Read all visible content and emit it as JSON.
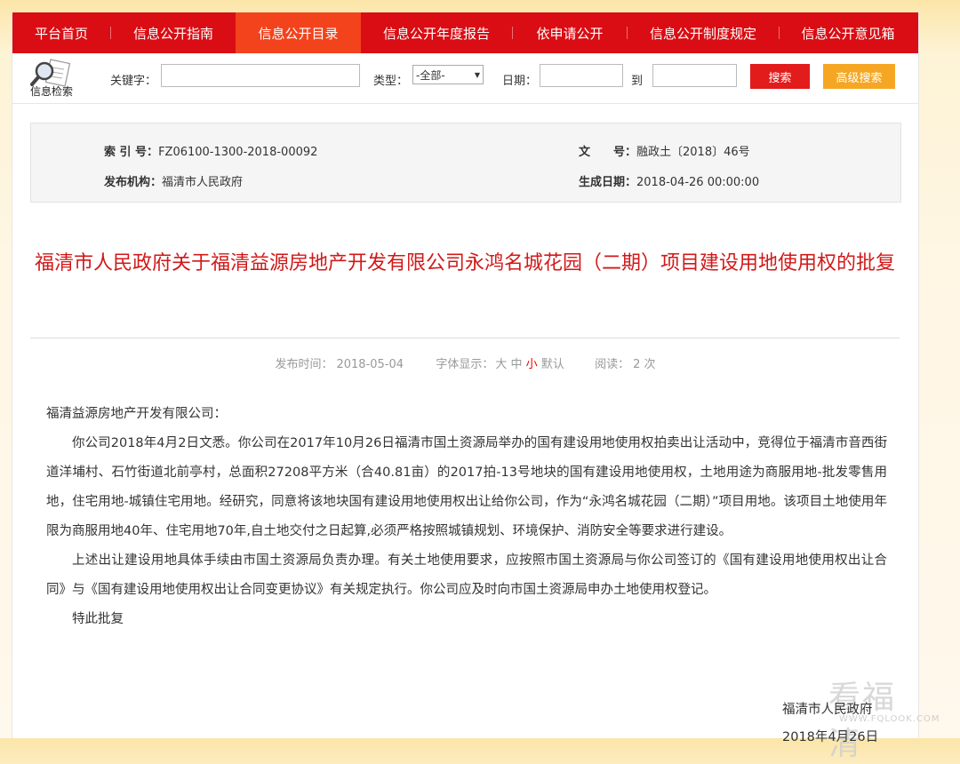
{
  "nav": {
    "items": [
      {
        "label": "平台首页",
        "active": false
      },
      {
        "label": "信息公开指南",
        "active": false
      },
      {
        "label": "信息公开目录",
        "active": true
      },
      {
        "label": "信息公开年度报告",
        "active": false
      },
      {
        "label": "依申请公开",
        "active": false
      },
      {
        "label": "信息公开制度规定",
        "active": false
      },
      {
        "label": "信息公开意见箱",
        "active": false
      }
    ]
  },
  "search": {
    "logo_label": "信息检索",
    "keyword_label": "关键字：",
    "keyword_value": "",
    "type_label": "类型：",
    "type_selected": "-全部-",
    "date_label": "日期：",
    "date_from": "",
    "to_label": "到",
    "date_to": "",
    "search_button": "搜索",
    "advanced_button": "高级搜索"
  },
  "meta": {
    "index_label": "索 引 号：",
    "index_value": "FZ06100-1300-2018-00092",
    "docno_label": "文　　号：",
    "docno_value": "融政土〔2018〕46号",
    "issuer_label": "发布机构：",
    "issuer_value": "福清市人民政府",
    "date_label": "生成日期：",
    "date_value": "2018-04-26 00:00:00"
  },
  "article": {
    "title": "福清市人民政府关于福清益源房地产开发有限公司永鸿名城花园（二期）项目建设用地使用权的批复",
    "pub_time_label": "发布时间：",
    "pub_time": "2018-05-04",
    "font_label": "字体显示：",
    "font_large": "大",
    "font_medium": "中",
    "font_small": "小",
    "font_default": "默认",
    "reads_label": "阅读：",
    "reads_value": "2 次",
    "salutation": "福清益源房地产开发有限公司：",
    "para1": "你公司2018年4月2日文悉。你公司在2017年10月26日福清市国土资源局举办的国有建设用地使用权拍卖出让活动中，竞得位于福清市音西街道洋埔村、石竹街道北前亭村，总面积27208平方米（合40.81亩）的2017拍-13号地块的国有建设用地使用权，土地用途为商服用地-批发零售用地，住宅用地-城镇住宅用地。经研究，同意将该地块国有建设用地使用权出让给你公司，作为“永鸿名城花园（二期）”项目用地。该项目土地使用年限为商服用地40年、住宅用地70年,自土地交付之日起算,必须严格按照城镇规划、环境保护、消防安全等要求进行建设。",
    "para2": "上述出让建设用地具体手续由市国土资源局负责办理。有关土地使用要求，应按照市国土资源局与你公司签订的《国有建设用地使用权出让合同》与《国有建设用地使用权出让合同变更协议》有关规定执行。你公司应及时向市国土资源局申办土地使用权登记。",
    "closing": "特此批复",
    "signature": "福清市人民政府",
    "sign_date": "2018年4月26日"
  },
  "watermark": {
    "text": "看福清",
    "url": "WWW.FQLOOK.COM"
  }
}
